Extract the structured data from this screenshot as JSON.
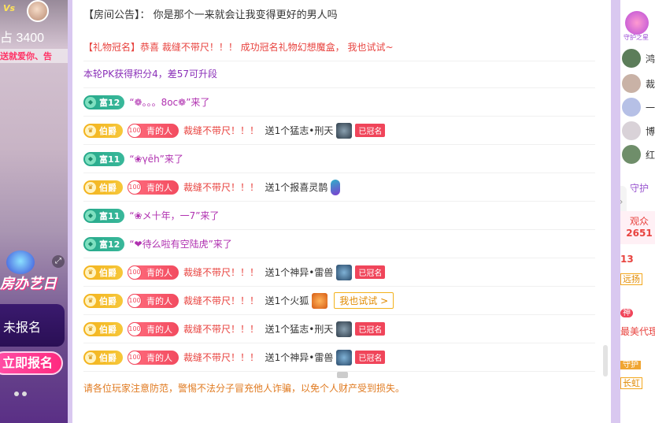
{
  "video": {
    "vs": "Vs",
    "score": "占 3400",
    "ticker": "送就爱你、告",
    "banner": "房办艺日",
    "unreg": "未报名",
    "signup": "立即报名"
  },
  "chat": {
    "notice_label": "【房间公告】：",
    "notice_text": "你是那个一来就会让我变得更好的男人吗",
    "gift_crown_label": "【礼物冠名】",
    "gift_crown_text": "恭喜 裁缝不带尺！！！ 成功冠名礼物幻想魔盒， 我也试试~",
    "pk": "本轮PK获得积分4，差57可升段",
    "messages": [
      {
        "type": "enter",
        "lvl": "富12",
        "name": "“❁。。。8oc❁”来了"
      },
      {
        "type": "gift",
        "rank": "伯爵",
        "fan_num": "100",
        "fan": "青的人",
        "user": "裁缝不带尺！！！",
        "act": "送1个猛志•刑天",
        "crown": "已冠名"
      },
      {
        "type": "enter",
        "lvl": "富11",
        "name": "“❀γēh”来了"
      },
      {
        "type": "gift",
        "rank": "伯爵",
        "fan_num": "100",
        "fan": "青的人",
        "user": "裁缝不带尺！！！",
        "act": "送1个报喜灵鹊",
        "crown": ""
      },
      {
        "type": "enter",
        "lvl": "富11",
        "name": "“❀メ十年，一7”来了"
      },
      {
        "type": "enter",
        "lvl": "富12",
        "name": "“❤待么啦有空陆虎”来了"
      },
      {
        "type": "gift",
        "rank": "伯爵",
        "fan_num": "100",
        "fan": "青的人",
        "user": "裁缝不带尺！！！",
        "act": "送1个神异•雷兽",
        "crown": "已冠名"
      },
      {
        "type": "gift",
        "rank": "伯爵",
        "fan_num": "100",
        "fan": "青的人",
        "user": "裁缝不带尺！！！",
        "act": "送1个火狐",
        "crown": "",
        "try": "我也试试 >"
      },
      {
        "type": "gift",
        "rank": "伯爵",
        "fan_num": "100",
        "fan": "青的人",
        "user": "裁缝不带尺！！！",
        "act": "送1个猛志•刑天",
        "crown": "已冠名"
      },
      {
        "type": "gift",
        "rank": "伯爵",
        "fan_num": "100",
        "fan": "青的人",
        "user": "裁缝不带尺！！！",
        "act": "送1个神异•雷兽",
        "crown": "已冠名"
      }
    ],
    "warning": "请各位玩家注意防范，警惕不法分子冒充他人诈骗，以免个人财产受到损失。"
  },
  "right": {
    "guard_label": "守护之星",
    "users": [
      "鸿",
      "裁",
      "一",
      "博",
      "红"
    ],
    "guard_tab": "守护",
    "audience_label": "观众",
    "audience_count": "2651",
    "r1": "13",
    "r1_tag": "远扬",
    "r2_tag": "神",
    "r3": "最美代理",
    "r4_tag": "守护",
    "r5_tag": "长虹"
  }
}
